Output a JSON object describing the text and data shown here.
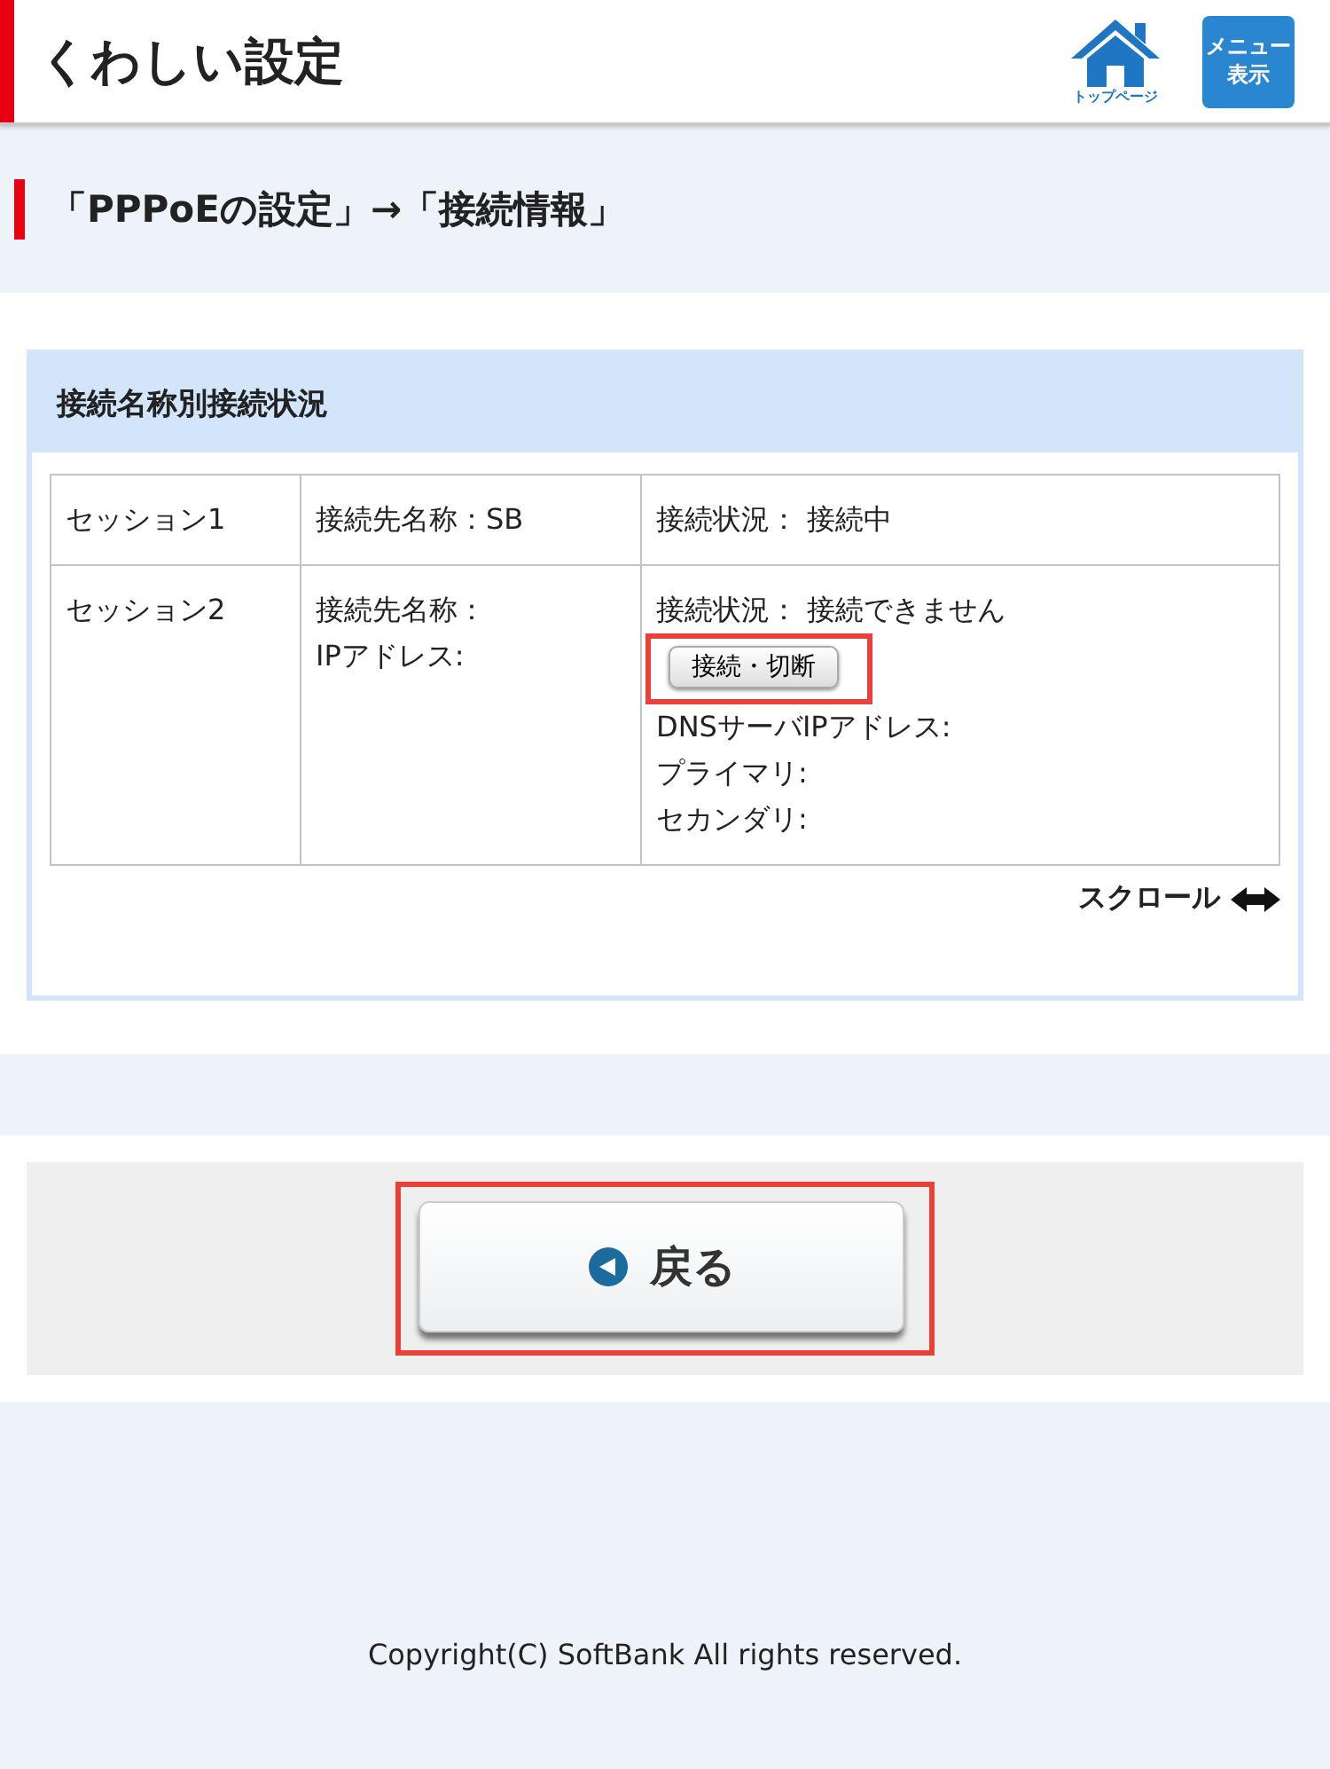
{
  "header": {
    "title": "くわしい設定",
    "home_label": "トップページ",
    "menu_button": "メニュー表示"
  },
  "breadcrumb": "「PPPoEの設定」→「接続情報」",
  "panel": {
    "title": "接続名称別接続状況",
    "rows": [
      {
        "cells": [
          [
            {
              "kind": "text",
              "text": "セッション1"
            }
          ],
          [
            {
              "kind": "text",
              "text": "接続先名称：SB"
            }
          ],
          [
            {
              "kind": "text",
              "text": "接続状況： 接続中"
            }
          ]
        ]
      },
      {
        "cells": [
          [
            {
              "kind": "text",
              "text": "セッション2"
            }
          ],
          [
            {
              "kind": "text",
              "text": "接続先名称："
            },
            {
              "kind": "text",
              "text": "IPアドレス:"
            }
          ],
          [
            {
              "kind": "text",
              "text": "接続状況： 接続できません"
            },
            {
              "kind": "button",
              "text": "接続・切断",
              "highlighted": true
            },
            {
              "kind": "text",
              "text": "DNSサーバIPアドレス:"
            },
            {
              "kind": "text",
              "text": "プライマリ:"
            },
            {
              "kind": "text",
              "text": "セカンダリ:"
            }
          ]
        ]
      }
    ],
    "scroll_hint": "スクロール"
  },
  "back_button": {
    "label": "戻る",
    "highlighted": true
  },
  "footer": "Copyright(C) SoftBank All rights reserved."
}
